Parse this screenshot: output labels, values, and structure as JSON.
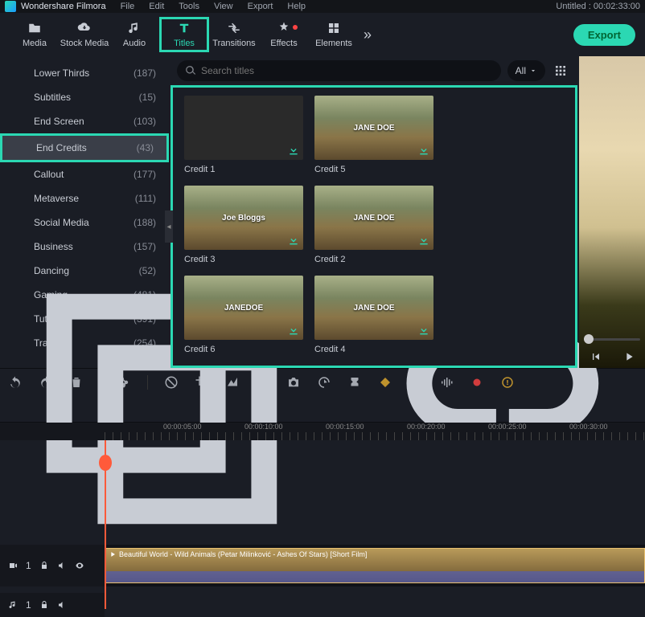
{
  "app_name": "Wondershare Filmora",
  "menu": [
    "File",
    "Edit",
    "Tools",
    "View",
    "Export",
    "Help"
  ],
  "project_title": "Untitled : 00:02:33:00",
  "top_tabs": [
    {
      "id": "media",
      "label": "Media"
    },
    {
      "id": "stock",
      "label": "Stock Media"
    },
    {
      "id": "audio",
      "label": "Audio"
    },
    {
      "id": "titles",
      "label": "Titles"
    },
    {
      "id": "transitions",
      "label": "Transitions"
    },
    {
      "id": "effects",
      "label": "Effects"
    },
    {
      "id": "elements",
      "label": "Elements"
    }
  ],
  "active_tab": "titles",
  "export_label": "Export",
  "sidebar": [
    {
      "label": "Lower Thirds",
      "count": "(187)"
    },
    {
      "label": "Subtitles",
      "count": "(15)"
    },
    {
      "label": "End Screen",
      "count": "(103)"
    },
    {
      "label": "End Credits",
      "count": "(43)"
    },
    {
      "label": "Callout",
      "count": "(177)"
    },
    {
      "label": "Metaverse",
      "count": "(111)"
    },
    {
      "label": "Social Media",
      "count": "(188)"
    },
    {
      "label": "Business",
      "count": "(157)"
    },
    {
      "label": "Dancing",
      "count": "(52)"
    },
    {
      "label": "Gaming",
      "count": "(481)"
    },
    {
      "label": "Tutorial",
      "count": "(391)"
    },
    {
      "label": "Travel",
      "count": "(254)"
    }
  ],
  "sidebar_selected": 3,
  "search_placeholder": "Search titles",
  "filter_label": "All",
  "thumbs": [
    {
      "name": "Credit 1",
      "overlay": "",
      "style": "credits-list"
    },
    {
      "name": "Credit 5",
      "overlay": "JANE DOE",
      "style": ""
    },
    {
      "name": "Credit 3",
      "overlay": "Joe Bloggs",
      "style": ""
    },
    {
      "name": "Credit 2",
      "overlay": "JANE DOE",
      "style": ""
    },
    {
      "name": "Credit 6",
      "overlay": "JANEDOE",
      "style": ""
    },
    {
      "name": "Credit 4",
      "overlay": "JANE DOE",
      "style": ""
    }
  ],
  "ruler": [
    "00:00:05:00",
    "00:00:10:00",
    "00:00:15:00",
    "00:00:20:00",
    "00:00:25:00",
    "00:00:30:00"
  ],
  "clip_title": "Beautiful World - Wild Animals (Petar Milinković - Ashes Of Stars) [Short Film]",
  "track_video": "1",
  "track_audio": "1"
}
